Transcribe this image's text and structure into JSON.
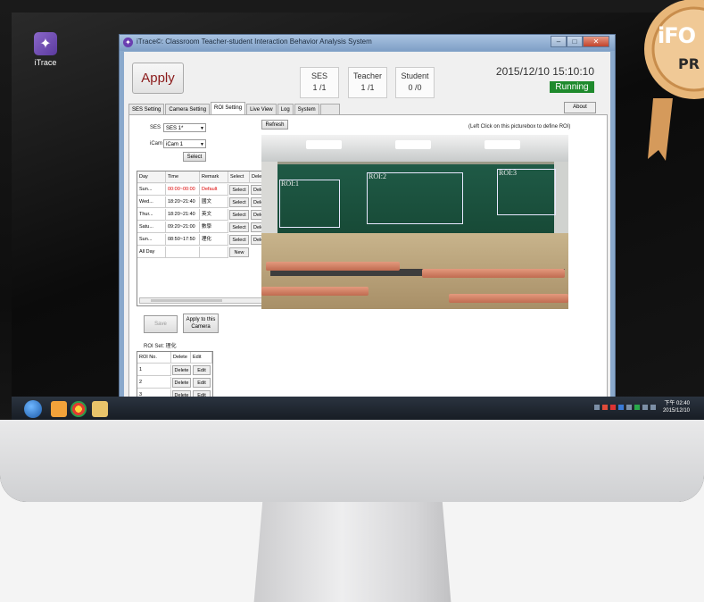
{
  "desktop": {
    "icon_label": "iTrace"
  },
  "window": {
    "title": "iTrace©: Classroom Teacher-student Interaction Behavior Analysis System"
  },
  "header": {
    "apply_label": "Apply",
    "stats": [
      {
        "label": "SES",
        "value": "1  /1"
      },
      {
        "label": "Teacher",
        "value": "1  /1"
      },
      {
        "label": "Student",
        "value": "0  /0"
      }
    ],
    "datetime": "2015/12/10 15:10:10",
    "status": "Running",
    "about_label": "About"
  },
  "tabs": [
    "SES Setting",
    "Camera Setting",
    "ROI Setting",
    "Live View",
    "Log",
    "System"
  ],
  "roi_setting": {
    "ses_label": "SES",
    "ses_value": "SES 1*",
    "icam_label": "iCam",
    "icam_value": "iCam 1",
    "select_label": "Select",
    "schedule_headers": [
      "Day",
      "Time",
      "Remark",
      "Select",
      "Delete"
    ],
    "schedule_rows": [
      {
        "day": "Sun...",
        "time": "00:00~00:00",
        "remark": "Default",
        "select": "Select",
        "delete": "Delete"
      },
      {
        "day": "Wed...",
        "time": "18:20~21:40",
        "remark": "國文",
        "select": "Select",
        "delete": "Delete"
      },
      {
        "day": "Thur...",
        "time": "18:20~21:40",
        "remark": "英文",
        "select": "Select",
        "delete": "Delete"
      },
      {
        "day": "Satu...",
        "time": "09:20~21:00",
        "remark": "數學",
        "select": "Select",
        "delete": "Delete"
      },
      {
        "day": "Sun...",
        "time": "08:50~17:50",
        "remark": "理化",
        "select": "Select",
        "delete": "Delete"
      }
    ],
    "new_row_day": "All Day",
    "new_label": "New",
    "save_label": "Save",
    "apply_camera_label": "Apply to this Camera",
    "roi_set_label": "ROI Set: 理化",
    "roi_headers": [
      "ROI No.",
      "Delete",
      "Edit"
    ],
    "roi_rows": [
      {
        "no": "1",
        "delete": "Delete",
        "edit": "Edit"
      },
      {
        "no": "2",
        "delete": "Delete",
        "edit": "Edit"
      },
      {
        "no": "3",
        "delete": "Delete",
        "edit": "Edit"
      }
    ],
    "refresh_label": "Refresh",
    "hint": "(Left Click on this picturebox to define ROI)",
    "roi_labels": [
      "ROI:1",
      "ROI:2",
      "ROI:3"
    ]
  },
  "taskbar": {
    "time": "下午 02:40",
    "date": "2015/12/10"
  },
  "badge": {
    "line1": "iFO",
    "line2": "PR"
  }
}
